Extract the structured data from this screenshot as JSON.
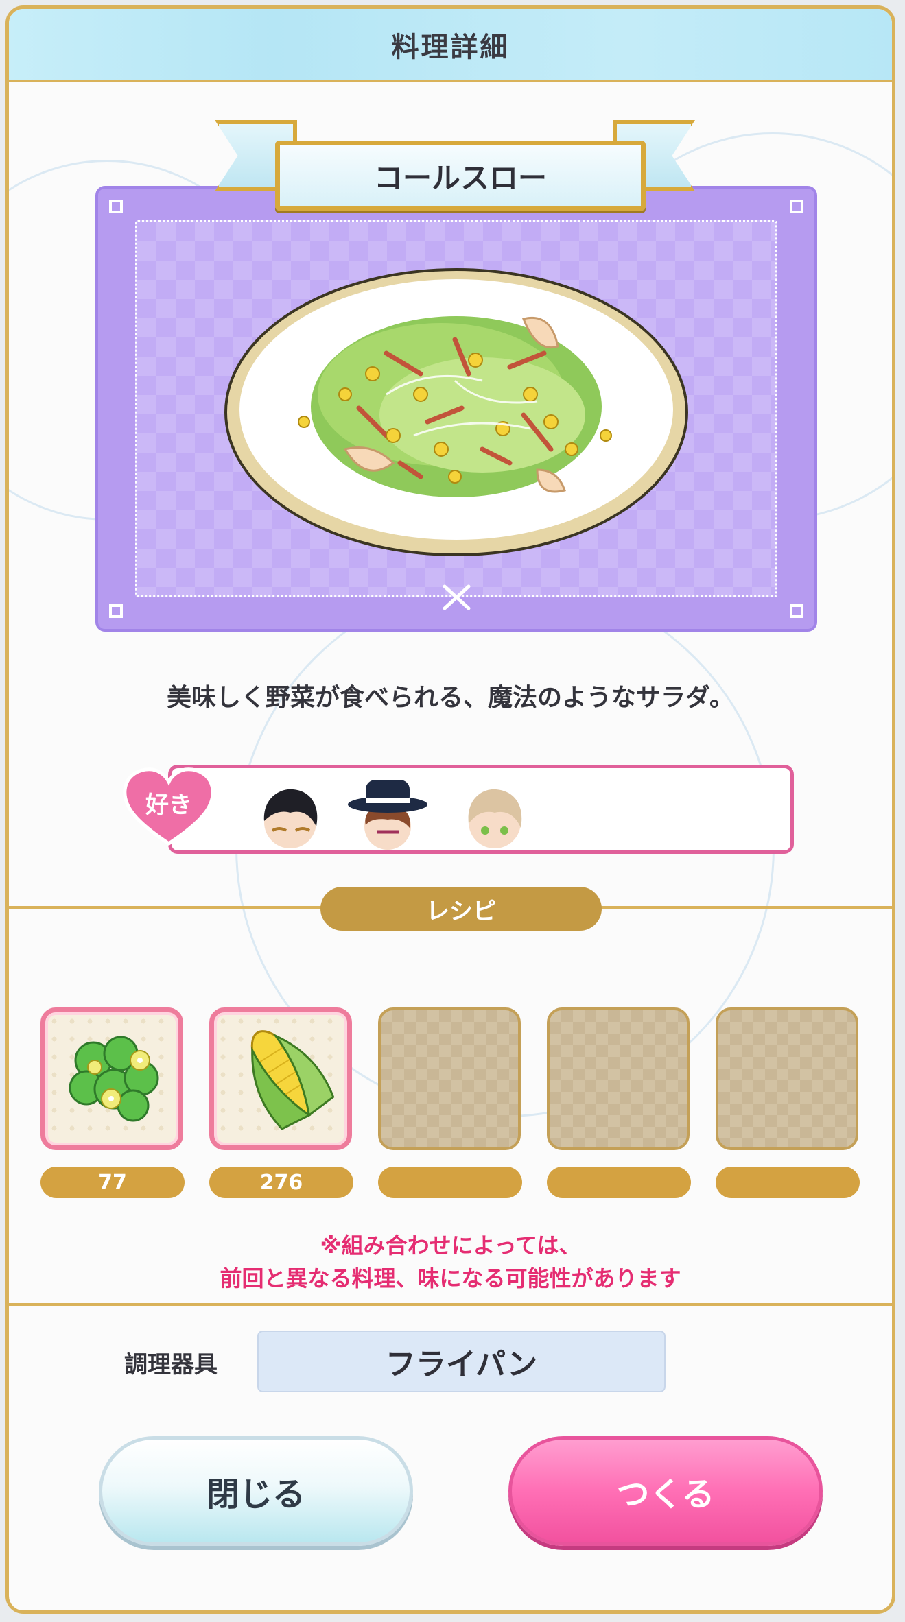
{
  "header": {
    "title": "料理詳細"
  },
  "dish": {
    "name": "コールスロー",
    "description": "美味しく野菜が食べられる、魔法のようなサラダ。"
  },
  "likes": {
    "label": "好き",
    "characters": [
      "character-dark-hair",
      "character-hat",
      "character-blonde"
    ]
  },
  "recipe": {
    "label": "レシピ",
    "slots": [
      {
        "ingredient": "green-flower-herb",
        "count": "77"
      },
      {
        "ingredient": "corn",
        "count": "276"
      },
      {
        "ingredient": "",
        "count": ""
      },
      {
        "ingredient": "",
        "count": ""
      },
      {
        "ingredient": "",
        "count": ""
      }
    ],
    "notice_line1": "※組み合わせによっては、",
    "notice_line2": "前回と異なる料理、味になる可能性があります"
  },
  "tool": {
    "label": "調理器具",
    "value": "フライパン"
  },
  "buttons": {
    "close": "閉じる",
    "make": "つくる"
  },
  "colors": {
    "accent_gold": "#d9b25a",
    "like_pink": "#e0609a",
    "notice_pink": "#e52d72",
    "dish_frame_purple": "#b69bf0",
    "make_button_pink": "#ff6fb5"
  }
}
